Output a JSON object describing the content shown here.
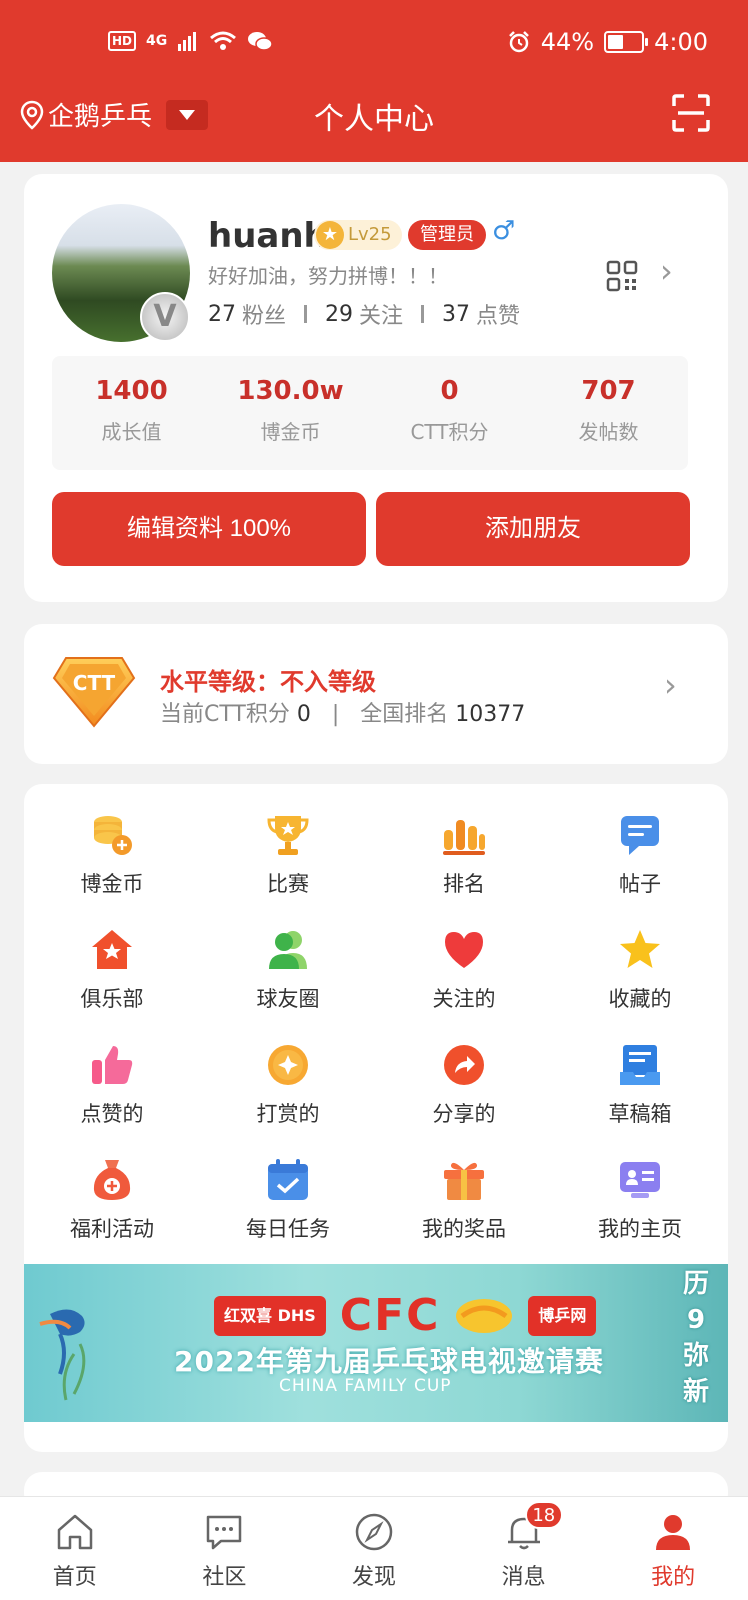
{
  "status_bar": {
    "hd": "HD",
    "network": "4G",
    "battery": "44%",
    "time": "4:00"
  },
  "header": {
    "location": "企鹅乒乓",
    "title": "个人中心"
  },
  "profile": {
    "username": "huanh",
    "level": "Lv25",
    "role": "管理员",
    "gender_symbol": "♂",
    "signature": "好好加油，努力拼博！！！",
    "fans_count": "27",
    "fans_label": "粉丝",
    "following_count": "29",
    "following_label": "关注",
    "likes_count": "37",
    "likes_label": "点赞"
  },
  "metrics": [
    {
      "value": "1400",
      "label": "成长值"
    },
    {
      "value": "130.0w",
      "label": "博金币"
    },
    {
      "value": "0",
      "label": "CTT积分"
    },
    {
      "value": "707",
      "label": "发帖数"
    }
  ],
  "buttons": {
    "edit": "编辑资料 100%",
    "add_friend": "添加朋友"
  },
  "ctt": {
    "badge": "CTT",
    "level_title": "水平等级：不入等级",
    "points_label": "当前CTT积分",
    "points_value": "0",
    "divider": "|",
    "rank_label": "全国排名",
    "rank_value": "10377"
  },
  "grid": [
    {
      "label": "博金币",
      "icon": "coins-icon"
    },
    {
      "label": "比赛",
      "icon": "trophy-icon"
    },
    {
      "label": "排名",
      "icon": "ranking-icon"
    },
    {
      "label": "帖子",
      "icon": "post-icon"
    },
    {
      "label": "俱乐部",
      "icon": "club-icon"
    },
    {
      "label": "球友圈",
      "icon": "friends-icon"
    },
    {
      "label": "关注的",
      "icon": "heart-icon"
    },
    {
      "label": "收藏的",
      "icon": "star-icon"
    },
    {
      "label": "点赞的",
      "icon": "thumbs-up-icon"
    },
    {
      "label": "打赏的",
      "icon": "reward-icon"
    },
    {
      "label": "分享的",
      "icon": "share-icon"
    },
    {
      "label": "草稿箱",
      "icon": "drafts-icon"
    },
    {
      "label": "福利活动",
      "icon": "welfare-icon"
    },
    {
      "label": "每日任务",
      "icon": "daily-task-icon"
    },
    {
      "label": "我的奖品",
      "icon": "gift-icon"
    },
    {
      "label": "我的主页",
      "icon": "homepage-icon"
    }
  ],
  "banner": {
    "logo1": "红双喜 DHS",
    "logo2": "CFC",
    "logo3": "博乒网",
    "title": "2022年第九届乒乓球电视邀请赛",
    "subtitle": "CHINA FAMILY CUP",
    "side_text": "历9弥新"
  },
  "tabs": [
    {
      "label": "首页",
      "icon": "home-icon"
    },
    {
      "label": "社区",
      "icon": "chat-icon"
    },
    {
      "label": "发现",
      "icon": "compass-icon"
    },
    {
      "label": "消息",
      "icon": "bell-icon",
      "badge": "18"
    },
    {
      "label": "我的",
      "icon": "person-icon",
      "active": true
    }
  ],
  "colors": {
    "primary": "#e03a2d",
    "value_red": "#c8302a",
    "gray": "#888888"
  }
}
